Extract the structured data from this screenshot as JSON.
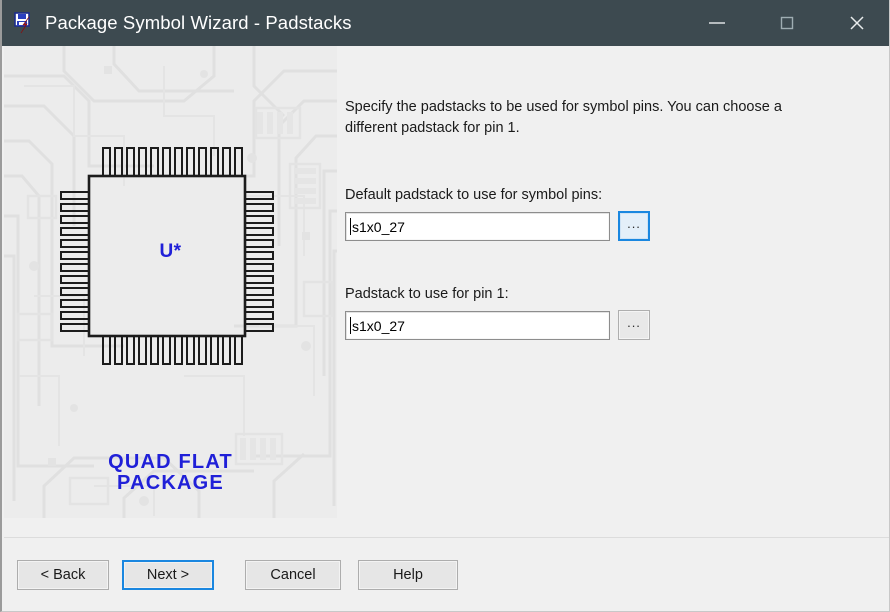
{
  "window": {
    "title": "Package Symbol Wizard - Padstacks",
    "icon": "package-symbol-wizard-icon",
    "controls": {
      "minimize": "minimize-icon",
      "maximize": "maximize-icon",
      "close": "close-icon"
    },
    "colors": {
      "titlebar": "#3d4a50",
      "content_bg": "#f0f0f0",
      "panel_bg": "#ececec",
      "accent": "#1a87e0",
      "illustration_text": "#2020d8"
    }
  },
  "illustration": {
    "reference_designator": "U*",
    "caption_line1": "QUAD FLAT",
    "caption_line2": "PACKAGE",
    "package_type": "quad-flat-package",
    "pins_per_side": 12
  },
  "content": {
    "instructions": "Specify the padstacks to be used for symbol pins. You can choose a different padstack for pin 1.",
    "fields": [
      {
        "label": "Default padstack to use for symbol pins:",
        "value": "s1x0_27",
        "browse_label": "...",
        "focused": true
      },
      {
        "label": "Padstack to use for pin 1:",
        "value": "s1x0_27",
        "browse_label": "...",
        "focused": false
      }
    ]
  },
  "footer": {
    "buttons": [
      {
        "label": "< Back",
        "name": "back-button",
        "default": false
      },
      {
        "label": "Next >",
        "name": "next-button",
        "default": true
      },
      {
        "label": "Cancel",
        "name": "cancel-button",
        "default": false
      },
      {
        "label": "Help",
        "name": "help-button",
        "default": false
      }
    ]
  }
}
